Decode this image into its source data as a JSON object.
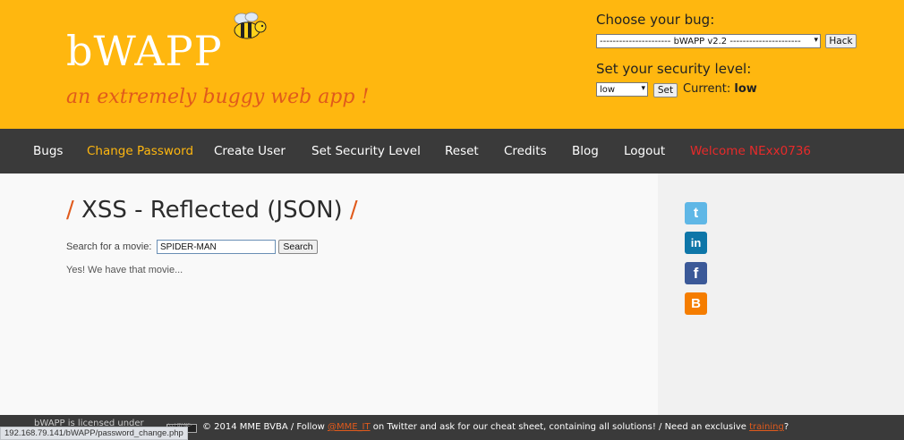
{
  "header": {
    "logo": "bWAPP",
    "tagline": "an extremely buggy web app !",
    "choose_bug_label": "Choose your bug:",
    "bug_select_value": "---------------------- bWAPP v2.2 ----------------------",
    "hack_button": "Hack",
    "security_label": "Set your security level:",
    "security_select_value": "low",
    "set_button": "Set",
    "current_label": "Current:",
    "current_value": "low"
  },
  "nav": {
    "items": [
      {
        "label": "Bugs"
      },
      {
        "label": "Change Password",
        "active": true
      },
      {
        "label": "Create User"
      },
      {
        "label": "Set Security Level"
      },
      {
        "label": "Reset"
      },
      {
        "label": "Credits"
      },
      {
        "label": "Blog"
      },
      {
        "label": "Logout"
      },
      {
        "label": "Welcome NExx0736"
      }
    ]
  },
  "main": {
    "title_slash_left": "/",
    "title": "XSS - Reflected (JSON)",
    "title_slash_right": "/",
    "search_label": "Search for a movie:",
    "search_value": "SPIDER-MAN",
    "search_button": "Search",
    "result": "Yes! We have that movie..."
  },
  "sidebar": {
    "icons": [
      "twitter-icon",
      "linkedin-icon",
      "facebook-icon",
      "blogger-icon"
    ]
  },
  "footer": {
    "left": "bWAPP is licensed under",
    "cc": "(cc) BY-NC-ND",
    "text_1": "© 2014 MME BVBA / Follow ",
    "twitter_link": "@MME_IT",
    "text_2": " on Twitter and ask for our cheat sheet, containing all solutions! / Need an exclusive ",
    "training_link": "training",
    "text_3": "?"
  },
  "statusbar": {
    "url": "192.168.79.141/bWAPP/password_change.php"
  },
  "colors": {
    "header_bg": "#ffb70f",
    "nav_bg": "#3a3a3a",
    "accent_orange": "#e05a1c",
    "welcome_red": "#e82a2a"
  }
}
